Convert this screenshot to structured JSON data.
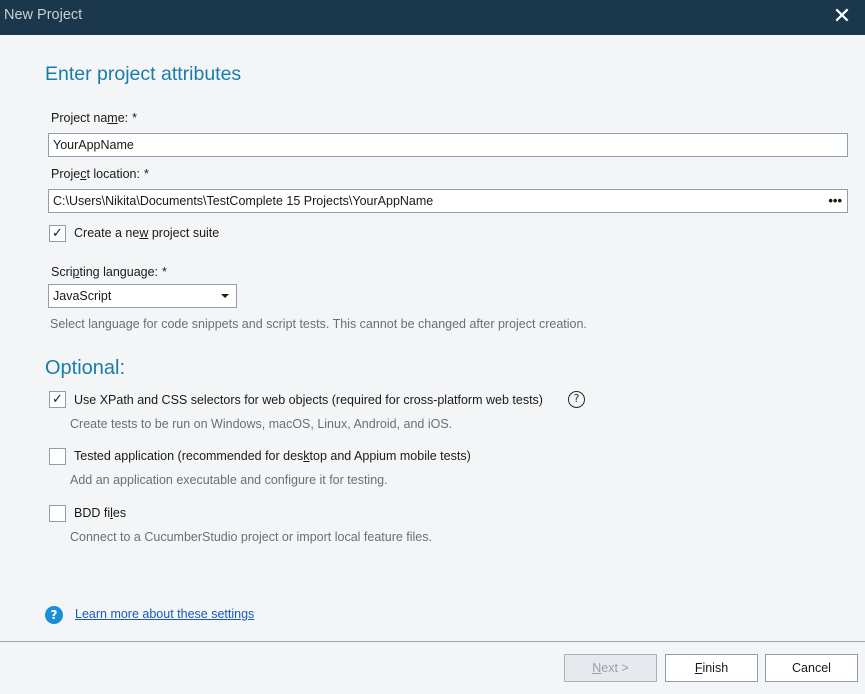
{
  "window": {
    "title": "New Project",
    "close_icon": "close-icon"
  },
  "section1": {
    "heading": "Enter project attributes",
    "project_name": {
      "label_pre": "Project na",
      "label_ul": "m",
      "label_post": "e:",
      "required": "*",
      "value": "YourAppName"
    },
    "project_location": {
      "label_pre": "Proje",
      "label_ul": "c",
      "label_post": "t location:",
      "required": "*",
      "value": "C:\\Users\\Nikita\\Documents\\TestComplete 15 Projects\\YourAppName",
      "browse_label": "•••"
    },
    "create_suite": {
      "checked": true,
      "label_pre": "Create a ne",
      "label_ul": "w",
      "label_post": " project suite"
    },
    "scripting_language": {
      "label_pre": "Scri",
      "label_ul": "p",
      "label_post": "ting language:",
      "required": "*",
      "selected": "JavaScript",
      "hint": "Select language for code snippets and script tests. This cannot be changed after project creation."
    }
  },
  "optional": {
    "heading": "Optional:",
    "items": [
      {
        "checked": true,
        "label_pre": "Use XPath and CSS selectors for web ob",
        "label_ul": "j",
        "label_post": "ects (required for cross-platform web tests)",
        "hint": "Create tests to be run on Windows, macOS, Linux, Android, and iOS.",
        "help_icon": "?"
      },
      {
        "checked": false,
        "label_pre": "Tested application (recommended for des",
        "label_ul": "k",
        "label_post": "top and Appium mobile tests)",
        "hint": "Add an application executable and configure it for testing."
      },
      {
        "checked": false,
        "label_pre": "BDD fi",
        "label_ul": "l",
        "label_post": "es",
        "hint": "Connect to a CucumberStudio project or import local feature files."
      }
    ]
  },
  "learn_more": {
    "icon": "?",
    "label": "Learn more about these settings"
  },
  "buttons": {
    "next": {
      "ul": "N",
      "rest": "ext >",
      "disabled": true
    },
    "finish": {
      "ul": "F",
      "rest": "inish"
    },
    "cancel": {
      "label": "Cancel"
    }
  },
  "colors": {
    "titlebar": "#1a374b",
    "heading": "#1a7da8",
    "link": "#1a58b8",
    "help_icon_bg": "#1a8fd6"
  }
}
